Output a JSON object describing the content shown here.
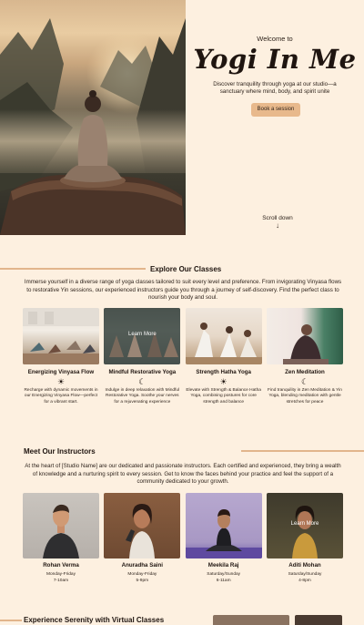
{
  "hero": {
    "welcome": "Welcome to",
    "brand": "Yogi In Me",
    "tagline": "Discover tranquility through yoga at our studio—a sanctuary where mind, body, and spirit unite",
    "cta_label": "Book a session",
    "scroll_label": "Scroll down",
    "scroll_icon": "↓"
  },
  "classes": {
    "heading": "Explore Our Classes",
    "intro": "Immerse yourself in a diverse range of yoga classes tailored to suit every level and preference. From invigorating Vinyasa flows to restorative Yin sessions, our experienced instructors guide you through a journey of self-discovery. Find the perfect class to nourish your body and soul.",
    "items": [
      {
        "title": "Energizing Vinyasa Flow",
        "icon": "sun-icon",
        "glyph": "☀",
        "desc": "Recharge with dynamic movements in our Energizing Vinyasa Flow—perfect for a vibrant start."
      },
      {
        "title": "Mindful Restorative Yoga",
        "icon": "moon-icon",
        "glyph": "☾",
        "desc": "Indulge in deep relaxation with Mindful Restorative Yoga. Soothe your nerves for a rejuvenating experience",
        "hover_label": "Learn More"
      },
      {
        "title": "Strength Hatha Yoga",
        "icon": "sun-icon",
        "glyph": "☀",
        "desc": "Elevate with Strength & Balance Hatha Yoga, combining postures for core strength and balance"
      },
      {
        "title": "Zen Meditation",
        "icon": "moon-icon",
        "glyph": "☾",
        "desc": "Find tranquility in Zen Meditation & Yin Yoga, blending meditation with gentle stretches for peace"
      }
    ]
  },
  "instructors": {
    "heading": "Meet Our Instructors",
    "intro": "At the heart of [Studio Name] are our dedicated and passionate instructors. Each certified and experienced, they bring a wealth of knowledge and a nurturing spirit to every session. Get to know the faces behind your practice and feel the support of a community dedicated to your growth.",
    "items": [
      {
        "name": "Rohan Verma",
        "days": "Monday-Friday",
        "time": "7-10am"
      },
      {
        "name": "Anuradha Saini",
        "days": "Monday-Friday",
        "time": "5-9pm"
      },
      {
        "name": "Meekila Raj",
        "days": "Saturday/Sunday",
        "time": "6-11am"
      },
      {
        "name": "Aditi Mohan",
        "days": "Saturday/Sunday",
        "time": "4-8pm",
        "hover_label": "Learn More"
      }
    ]
  },
  "virtual": {
    "heading": "Experience Serenity with Virtual Classes"
  },
  "colors": {
    "background": "#fdf0e0",
    "accent": "#e8b98c",
    "rule": "#e2b58c",
    "text": "#2a1f18"
  }
}
